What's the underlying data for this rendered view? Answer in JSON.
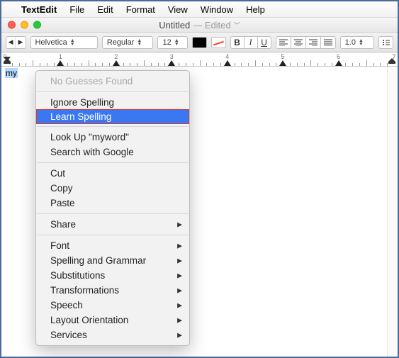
{
  "menubar": {
    "app": "TextEdit",
    "items": [
      "File",
      "Edit",
      "Format",
      "View",
      "Window",
      "Help"
    ]
  },
  "window": {
    "title": "Untitled",
    "subtitle": "— Edited"
  },
  "toolbar": {
    "font_family": "Helvetica",
    "font_style": "Regular",
    "font_size": "12",
    "bold": "B",
    "italic": "I",
    "underline": "U",
    "spacing": "1.0"
  },
  "ruler": {
    "labels": [
      "0",
      "1",
      "2",
      "3",
      "4",
      "5",
      "6",
      "7"
    ]
  },
  "editor": {
    "selected_text": "my"
  },
  "context_menu": {
    "no_guesses": "No Guesses Found",
    "ignore": "Ignore Spelling",
    "learn": "Learn Spelling",
    "lookup": "Look Up \"myword\"",
    "search": "Search with Google",
    "cut": "Cut",
    "copy": "Copy",
    "paste": "Paste",
    "share": "Share",
    "font": "Font",
    "spelling": "Spelling and Grammar",
    "subs": "Substitutions",
    "trans": "Transformations",
    "speech": "Speech",
    "layout": "Layout Orientation",
    "services": "Services"
  }
}
